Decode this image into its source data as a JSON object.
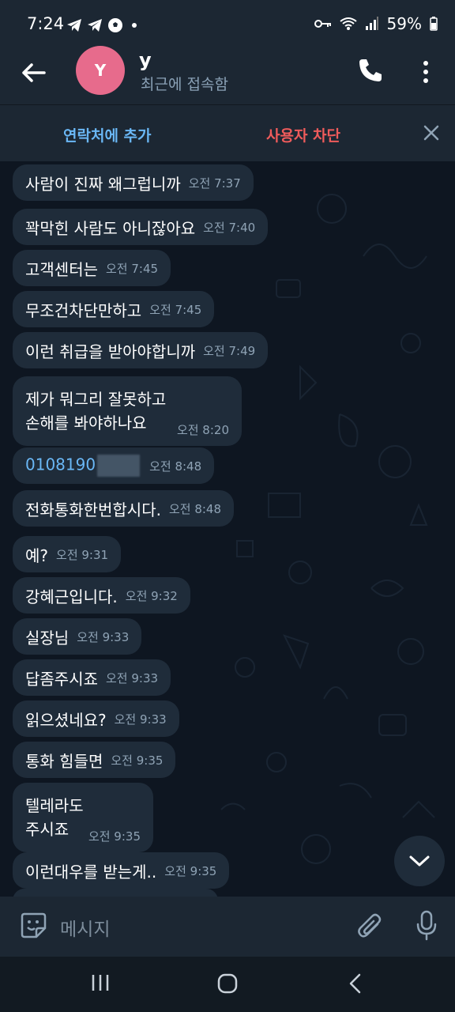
{
  "status_bar": {
    "time": "7:24",
    "battery": "59%"
  },
  "header": {
    "avatar_letter": "Y",
    "contact_name": "y",
    "contact_status": "최근에 접속함"
  },
  "action_bar": {
    "add_contact": "연락처에 추가",
    "block_user": "사용자 차단"
  },
  "messages": [
    {
      "text": "사람이 진짜 왜그럽니까",
      "time": "오전 7:37"
    },
    {
      "text": "꽉막힌 사람도 아니잖아요",
      "time": "오전 7:40"
    },
    {
      "text": "고객센터는",
      "time": "오전 7:45"
    },
    {
      "text": "무조건차단만하고",
      "time": "오전 7:45"
    },
    {
      "text": "이런 취급을 받아야합니까",
      "time": "오전 7:49"
    },
    {
      "text": "제가 뭐그리 잘못하고\n손해를 봐야하나요",
      "time": "오전 8:20"
    },
    {
      "text": "0108190",
      "time": "오전 8:48"
    },
    {
      "text": "전화통화한번합시다.",
      "time": "오전 8:48"
    },
    {
      "text": "예?",
      "time": "오전 9:31"
    },
    {
      "text": "강혜근입니다.",
      "time": "오전 9:32"
    },
    {
      "text": "실장님",
      "time": "오전 9:33"
    },
    {
      "text": "답좀주시죠",
      "time": "오전 9:33"
    },
    {
      "text": "읽으셨네요?",
      "time": "오전 9:33"
    },
    {
      "text": "통화 힘들면",
      "time": "오전 9:35"
    },
    {
      "text": "텔레라도\n주시죠",
      "time": "오전 9:35"
    },
    {
      "text": "이런대우를 받는게..",
      "time": "오전 9:35"
    }
  ],
  "input": {
    "placeholder": "메시지"
  },
  "colors": {
    "accent": "#6ab7f5",
    "danger": "#ef5b5b",
    "bubble": "#1f2c3a",
    "background": "#0e1621",
    "avatar": "#e76b8c"
  }
}
